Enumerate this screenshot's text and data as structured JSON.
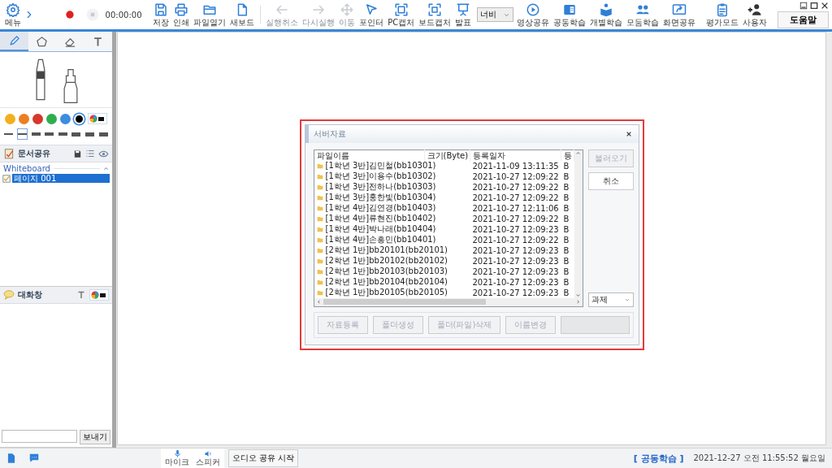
{
  "toolbar": {
    "menu": {
      "label": "메뉴"
    },
    "timer": "00:00:00",
    "left_tools": [
      {
        "label": "저장",
        "disabled": false
      },
      {
        "label": "인쇄",
        "disabled": false
      },
      {
        "label": "파일열기",
        "disabled": false
      },
      {
        "label": "새보드",
        "disabled": false
      },
      {
        "label": "실행취소",
        "disabled": true
      },
      {
        "label": "다시실행",
        "disabled": true
      },
      {
        "label": "이동",
        "disabled": true
      },
      {
        "label": "포인터",
        "disabled": false
      },
      {
        "label": "PC캡처",
        "disabled": false
      },
      {
        "label": "보드캡처",
        "disabled": false
      },
      {
        "label": "발표",
        "disabled": false
      }
    ],
    "width_select": "너비",
    "right_tools": [
      {
        "label": "영상공유"
      },
      {
        "label": "공동학습"
      },
      {
        "label": "개별학습"
      },
      {
        "label": "모둠학습"
      },
      {
        "label": "화면공유"
      },
      {
        "label": "평가모드"
      },
      {
        "label": "사용자"
      }
    ],
    "help_button": "도움말"
  },
  "left_panel": {
    "tool_tabs": [
      {
        "selected": true
      },
      {
        "selected": false
      },
      {
        "selected": false
      },
      {
        "selected": false
      }
    ],
    "pen_colors": [
      {
        "color": "#f2b01e",
        "selected": false
      },
      {
        "color": "#ef7d22",
        "selected": false
      },
      {
        "color": "#d6382c",
        "selected": false
      },
      {
        "color": "#2fae4e",
        "selected": false
      },
      {
        "color": "#3b8de0",
        "selected": false
      },
      {
        "color": "#000000",
        "selected": true
      }
    ],
    "line_widths": [
      {
        "selected": false
      },
      {
        "selected": true
      },
      {
        "selected": false
      },
      {
        "selected": false
      },
      {
        "selected": false
      },
      {
        "selected": false
      },
      {
        "selected": false
      },
      {
        "selected": false
      }
    ],
    "documents": {
      "title": "문서공유",
      "group": "Whiteboard",
      "pages": [
        {
          "label": "페이지 001",
          "checked": true,
          "selected": true
        }
      ]
    },
    "chat": {
      "title": "대화창",
      "send_button": "보내기"
    }
  },
  "dialog": {
    "title": "서버자료",
    "columns": [
      "파일이름",
      "크기(Byte)",
      "등록일자",
      "등"
    ],
    "rows": [
      {
        "name": "[1학년 3반]김민철(bb10301)",
        "date": "2021-11-09 13:11:35",
        "column_4": "B"
      },
      {
        "name": "[1학년 3반]이용수(bb10302)",
        "date": "2021-10-27 12:09:22",
        "column_4": "B"
      },
      {
        "name": "[1학년 3반]전하나(bb10303)",
        "date": "2021-10-27 12:09:22",
        "column_4": "B"
      },
      {
        "name": "[1학년 3반]홍한빛(bb10304)",
        "date": "2021-10-27 12:09:22",
        "column_4": "B"
      },
      {
        "name": "[1학년 4반]김연경(bb10403)",
        "date": "2021-10-27 12:11:06",
        "column_4": "B"
      },
      {
        "name": "[1학년 4반]류현진(bb10402)",
        "date": "2021-10-27 12:09:22",
        "column_4": "B"
      },
      {
        "name": "[1학년 4반]박나래(bb10404)",
        "date": "2021-10-27 12:09:23",
        "column_4": "B"
      },
      {
        "name": "[1학년 4반]손흥민(bb10401)",
        "date": "2021-10-27 12:09:22",
        "column_4": "B"
      },
      {
        "name": "[2학년 1반]bb20101(bb20101)",
        "date": "2021-10-27 12:09:23",
        "column_4": "B"
      },
      {
        "name": "[2학년 1반]bb20102(bb20102)",
        "date": "2021-10-27 12:09:23",
        "column_4": "B"
      },
      {
        "name": "[2학년 1반]bb20103(bb20103)",
        "date": "2021-10-27 12:09:23",
        "column_4": "B"
      },
      {
        "name": "[2학년 1반]bb20104(bb20104)",
        "date": "2021-10-27 12:09:23",
        "column_4": "B"
      },
      {
        "name": "[2학년 1반]bb20105(bb20105)",
        "date": "2021-10-27 12:09:23",
        "column_4": "B"
      }
    ],
    "side_buttons": [
      {
        "label": "불러오기",
        "disabled": true
      },
      {
        "label": "취소",
        "disabled": false
      }
    ],
    "category_select": "과제",
    "bottom_buttons": [
      {
        "label": "자료등록",
        "disabled": true
      },
      {
        "label": "폴더생성",
        "disabled": true
      },
      {
        "label": "폴더(파일)삭제",
        "disabled": true
      },
      {
        "label": "이름변경",
        "disabled": true
      }
    ]
  },
  "status_bar": {
    "mic_label": "마이크",
    "speaker_label": "스피커",
    "audio_button": "오디오 공유 시작",
    "mode": "[ 공동학습 ]",
    "datetime": "2021-12-27 오전 11:55:52 월요일"
  }
}
